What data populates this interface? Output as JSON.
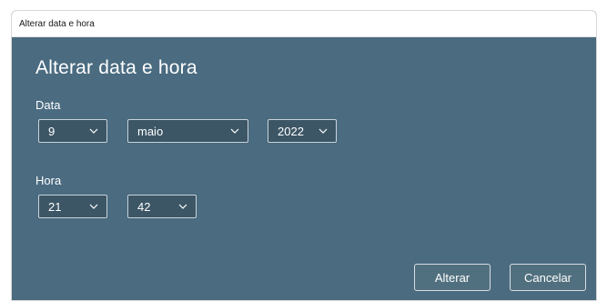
{
  "window": {
    "title": "Alterar data e hora"
  },
  "dialog": {
    "heading": "Alterar data e hora",
    "date_label": "Data",
    "day": "9",
    "month": "maio",
    "year": "2022",
    "time_label": "Hora",
    "hour": "21",
    "minute": "42"
  },
  "buttons": {
    "change": "Alterar",
    "cancel": "Cancelar"
  },
  "colors": {
    "dialog_bg": "#4a6b80",
    "select_bg": "#3c5666",
    "text": "#ffffff"
  }
}
